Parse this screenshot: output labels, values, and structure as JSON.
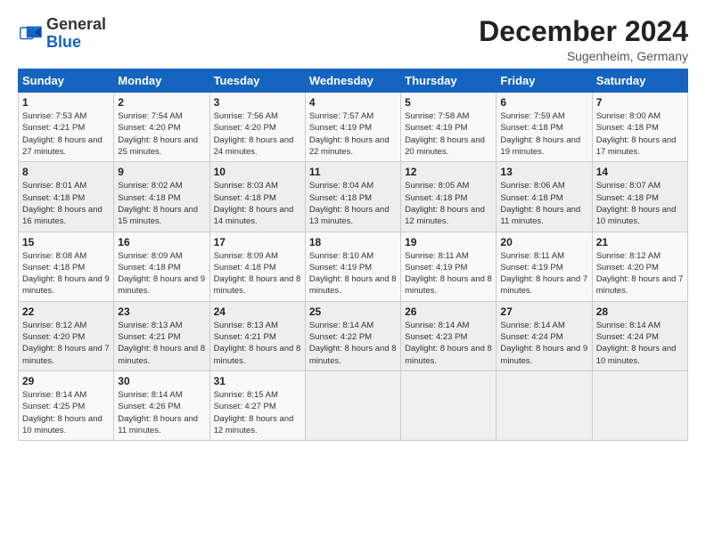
{
  "logo": {
    "general": "General",
    "blue": "Blue"
  },
  "title": "December 2024",
  "subtitle": "Sugenheim, Germany",
  "days_header": [
    "Sunday",
    "Monday",
    "Tuesday",
    "Wednesday",
    "Thursday",
    "Friday",
    "Saturday"
  ],
  "weeks": [
    [
      {
        "day": "1",
        "sunrise": "7:53 AM",
        "sunset": "4:21 PM",
        "daylight": "8 hours and 27 minutes."
      },
      {
        "day": "2",
        "sunrise": "7:54 AM",
        "sunset": "4:20 PM",
        "daylight": "8 hours and 25 minutes."
      },
      {
        "day": "3",
        "sunrise": "7:56 AM",
        "sunset": "4:20 PM",
        "daylight": "8 hours and 24 minutes."
      },
      {
        "day": "4",
        "sunrise": "7:57 AM",
        "sunset": "4:19 PM",
        "daylight": "8 hours and 22 minutes."
      },
      {
        "day": "5",
        "sunrise": "7:58 AM",
        "sunset": "4:19 PM",
        "daylight": "8 hours and 20 minutes."
      },
      {
        "day": "6",
        "sunrise": "7:59 AM",
        "sunset": "4:18 PM",
        "daylight": "8 hours and 19 minutes."
      },
      {
        "day": "7",
        "sunrise": "8:00 AM",
        "sunset": "4:18 PM",
        "daylight": "8 hours and 17 minutes."
      }
    ],
    [
      {
        "day": "8",
        "sunrise": "8:01 AM",
        "sunset": "4:18 PM",
        "daylight": "8 hours and 16 minutes."
      },
      {
        "day": "9",
        "sunrise": "8:02 AM",
        "sunset": "4:18 PM",
        "daylight": "8 hours and 15 minutes."
      },
      {
        "day": "10",
        "sunrise": "8:03 AM",
        "sunset": "4:18 PM",
        "daylight": "8 hours and 14 minutes."
      },
      {
        "day": "11",
        "sunrise": "8:04 AM",
        "sunset": "4:18 PM",
        "daylight": "8 hours and 13 minutes."
      },
      {
        "day": "12",
        "sunrise": "8:05 AM",
        "sunset": "4:18 PM",
        "daylight": "8 hours and 12 minutes."
      },
      {
        "day": "13",
        "sunrise": "8:06 AM",
        "sunset": "4:18 PM",
        "daylight": "8 hours and 11 minutes."
      },
      {
        "day": "14",
        "sunrise": "8:07 AM",
        "sunset": "4:18 PM",
        "daylight": "8 hours and 10 minutes."
      }
    ],
    [
      {
        "day": "15",
        "sunrise": "8:08 AM",
        "sunset": "4:18 PM",
        "daylight": "8 hours and 9 minutes."
      },
      {
        "day": "16",
        "sunrise": "8:09 AM",
        "sunset": "4:18 PM",
        "daylight": "8 hours and 9 minutes."
      },
      {
        "day": "17",
        "sunrise": "8:09 AM",
        "sunset": "4:18 PM",
        "daylight": "8 hours and 8 minutes."
      },
      {
        "day": "18",
        "sunrise": "8:10 AM",
        "sunset": "4:19 PM",
        "daylight": "8 hours and 8 minutes."
      },
      {
        "day": "19",
        "sunrise": "8:11 AM",
        "sunset": "4:19 PM",
        "daylight": "8 hours and 8 minutes."
      },
      {
        "day": "20",
        "sunrise": "8:11 AM",
        "sunset": "4:19 PM",
        "daylight": "8 hours and 7 minutes."
      },
      {
        "day": "21",
        "sunrise": "8:12 AM",
        "sunset": "4:20 PM",
        "daylight": "8 hours and 7 minutes."
      }
    ],
    [
      {
        "day": "22",
        "sunrise": "8:12 AM",
        "sunset": "4:20 PM",
        "daylight": "8 hours and 7 minutes."
      },
      {
        "day": "23",
        "sunrise": "8:13 AM",
        "sunset": "4:21 PM",
        "daylight": "8 hours and 8 minutes."
      },
      {
        "day": "24",
        "sunrise": "8:13 AM",
        "sunset": "4:21 PM",
        "daylight": "8 hours and 8 minutes."
      },
      {
        "day": "25",
        "sunrise": "8:14 AM",
        "sunset": "4:22 PM",
        "daylight": "8 hours and 8 minutes."
      },
      {
        "day": "26",
        "sunrise": "8:14 AM",
        "sunset": "4:23 PM",
        "daylight": "8 hours and 8 minutes."
      },
      {
        "day": "27",
        "sunrise": "8:14 AM",
        "sunset": "4:24 PM",
        "daylight": "8 hours and 9 minutes."
      },
      {
        "day": "28",
        "sunrise": "8:14 AM",
        "sunset": "4:24 PM",
        "daylight": "8 hours and 10 minutes."
      }
    ],
    [
      {
        "day": "29",
        "sunrise": "8:14 AM",
        "sunset": "4:25 PM",
        "daylight": "8 hours and 10 minutes."
      },
      {
        "day": "30",
        "sunrise": "8:14 AM",
        "sunset": "4:26 PM",
        "daylight": "8 hours and 11 minutes."
      },
      {
        "day": "31",
        "sunrise": "8:15 AM",
        "sunset": "4:27 PM",
        "daylight": "8 hours and 12 minutes."
      },
      null,
      null,
      null,
      null
    ]
  ]
}
